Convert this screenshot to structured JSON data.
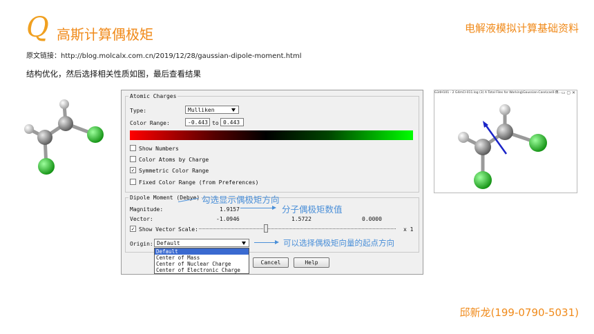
{
  "header": {
    "logo_letter": "Q",
    "title": "高斯计算偶极矩",
    "brand": "电解液模拟计算基础资料"
  },
  "link": {
    "label": "原文链接：",
    "url": "http://blog.molcalx.com.cn/2019/12/28/gaussian-dipole-moment.html"
  },
  "description": "结构优化，然后选择相关性质如图，最后查看结果",
  "dialog": {
    "atomic_charges_title": "Atomic Charges",
    "type_label": "Type:",
    "type_value": "Mulliken",
    "color_range_label": "Color Range:",
    "color_range_min": "-0.443",
    "color_range_to": "to",
    "color_range_max": "0.443",
    "checkboxes": [
      {
        "label": "Show Numbers",
        "checked": false
      },
      {
        "label": "Color Atoms by Charge",
        "checked": false
      },
      {
        "label": "Symmetric Color Range",
        "checked": true
      },
      {
        "label": "Fixed Color Range (from Preferences)",
        "checked": false
      }
    ],
    "dipole_title": "Dipole Moment (Debye)",
    "magnitude_label": "Magnitude:",
    "magnitude_value": "1.9157",
    "vector_label": "Vector:",
    "vector_x": "-1.0946",
    "vector_y": "1.5722",
    "vector_z": "0.0000",
    "show_vector_label": "Show Vector",
    "show_vector_checked": true,
    "scale_label": "Scale:",
    "scale_suffix": "x 1",
    "scale_value": 0.35,
    "origin_label": "Origin:",
    "origin_value": "Default",
    "origin_options": [
      "Default",
      "Center of Mass",
      "Center of Nuclear Charge",
      "Center of Electronic Charge"
    ],
    "cancel_label": "Cancel",
    "help_label": "Help"
  },
  "annotations": {
    "show_dipole": "勾选显示偶极矩方向",
    "dipole_value": "分子偶极矩数值",
    "origin_choice": "可以选择偶极矩向量的起点方向"
  },
  "viewer": {
    "window_title": "G34H101 - 2 G4mCl-011.log (3) A Total Files for Working\\Gaussian-Case\\cas0-偶..."
  },
  "contact": "邱新龙(199-0790-5031)",
  "colors": {
    "accent": "#f08a1a",
    "annotation": "#4a8fd8",
    "carbon": "#8c8c8c",
    "hydrogen": "#d8d8d8",
    "chlorine": "#22c422"
  }
}
